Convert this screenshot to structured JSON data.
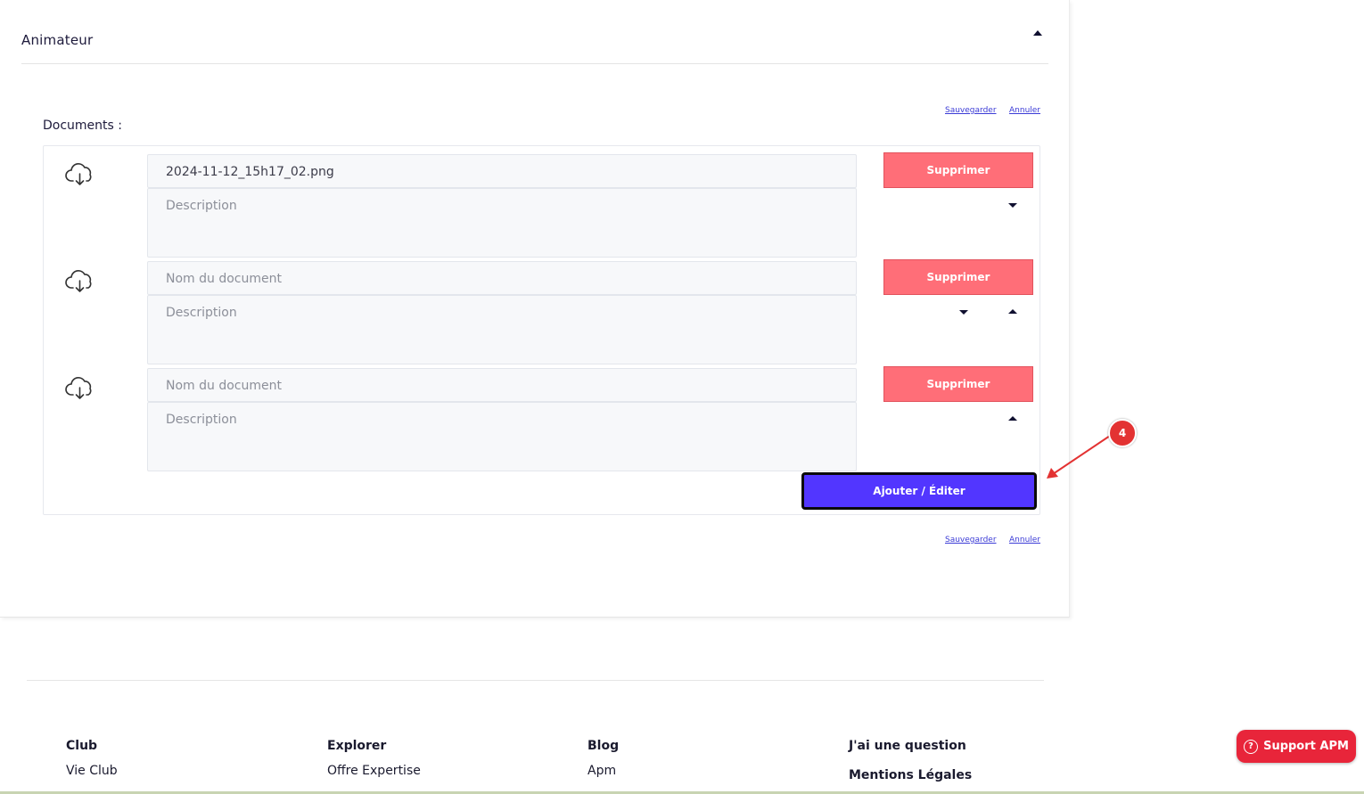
{
  "section": {
    "title": "Animateur",
    "save_label": "Sauvegarder",
    "cancel_label": "Annuler"
  },
  "documents": {
    "label": "Documents :",
    "delete_label": "Supprimer",
    "items": [
      {
        "name": "2024-11-12_15h17_02.png",
        "name_placeholder": "Nom du document",
        "description_placeholder": "Description"
      },
      {
        "name": "",
        "name_placeholder": "Nom du document",
        "description_placeholder": "Description"
      },
      {
        "name": "",
        "name_placeholder": "Nom du document",
        "description_placeholder": "Description"
      }
    ],
    "add_edit_label": "Ajouter / Éditer"
  },
  "annotation": {
    "step": "4",
    "color": "#e33232"
  },
  "footer": {
    "columns": [
      {
        "heading": "Club",
        "link": "Vie Club"
      },
      {
        "heading": "Explorer",
        "link": "Offre Expertise"
      },
      {
        "heading": "Blog",
        "link": "Apm"
      },
      {
        "heading": "J'ai une question",
        "link": "Mentions Légales"
      }
    ]
  },
  "support": {
    "label": "Support APM",
    "icon": "question-circle-icon"
  },
  "colors": {
    "delete": "#ff6e78",
    "primary": "#5236ff",
    "support": "#e8253a"
  }
}
